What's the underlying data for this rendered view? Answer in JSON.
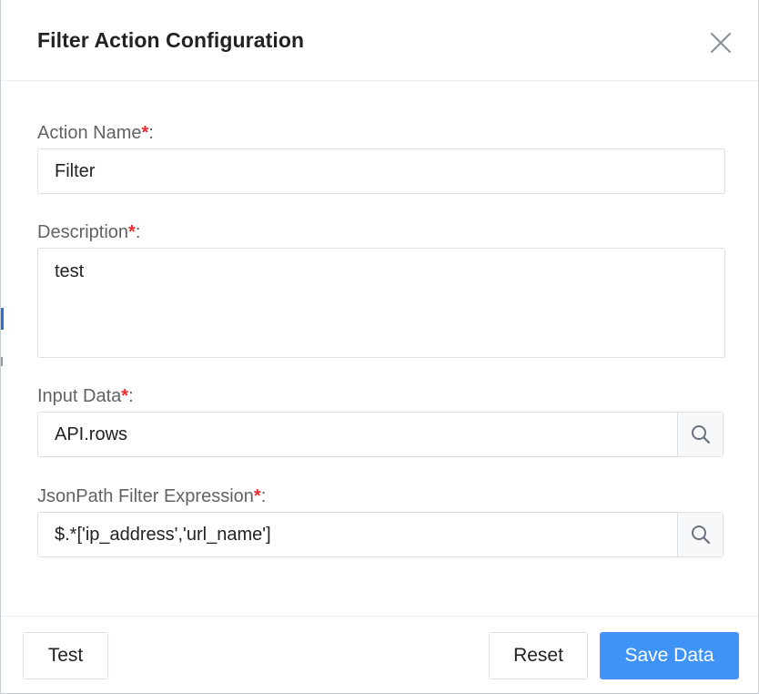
{
  "dialog": {
    "title": "Filter Action Configuration",
    "close_icon": "close-icon"
  },
  "form": {
    "action_name": {
      "label": "Action Name",
      "required_mark": "*",
      "suffix": ":",
      "value": "Filter"
    },
    "description": {
      "label": "Description",
      "required_mark": "*",
      "suffix": ":",
      "value": "test"
    },
    "input_data": {
      "label": "Input Data",
      "required_mark": "*",
      "suffix": ":",
      "value": "API.rows",
      "icon": "search-icon"
    },
    "jsonpath": {
      "label": "JsonPath Filter Expression",
      "required_mark": "*",
      "suffix": ":",
      "value": "$.*['ip_address','url_name']",
      "icon": "search-icon"
    }
  },
  "footer": {
    "test_label": "Test",
    "reset_label": "Reset",
    "save_label": "Save Data"
  },
  "colors": {
    "primary": "#3f93f7",
    "required": "#f02b2b",
    "border": "#dcdfe6"
  }
}
